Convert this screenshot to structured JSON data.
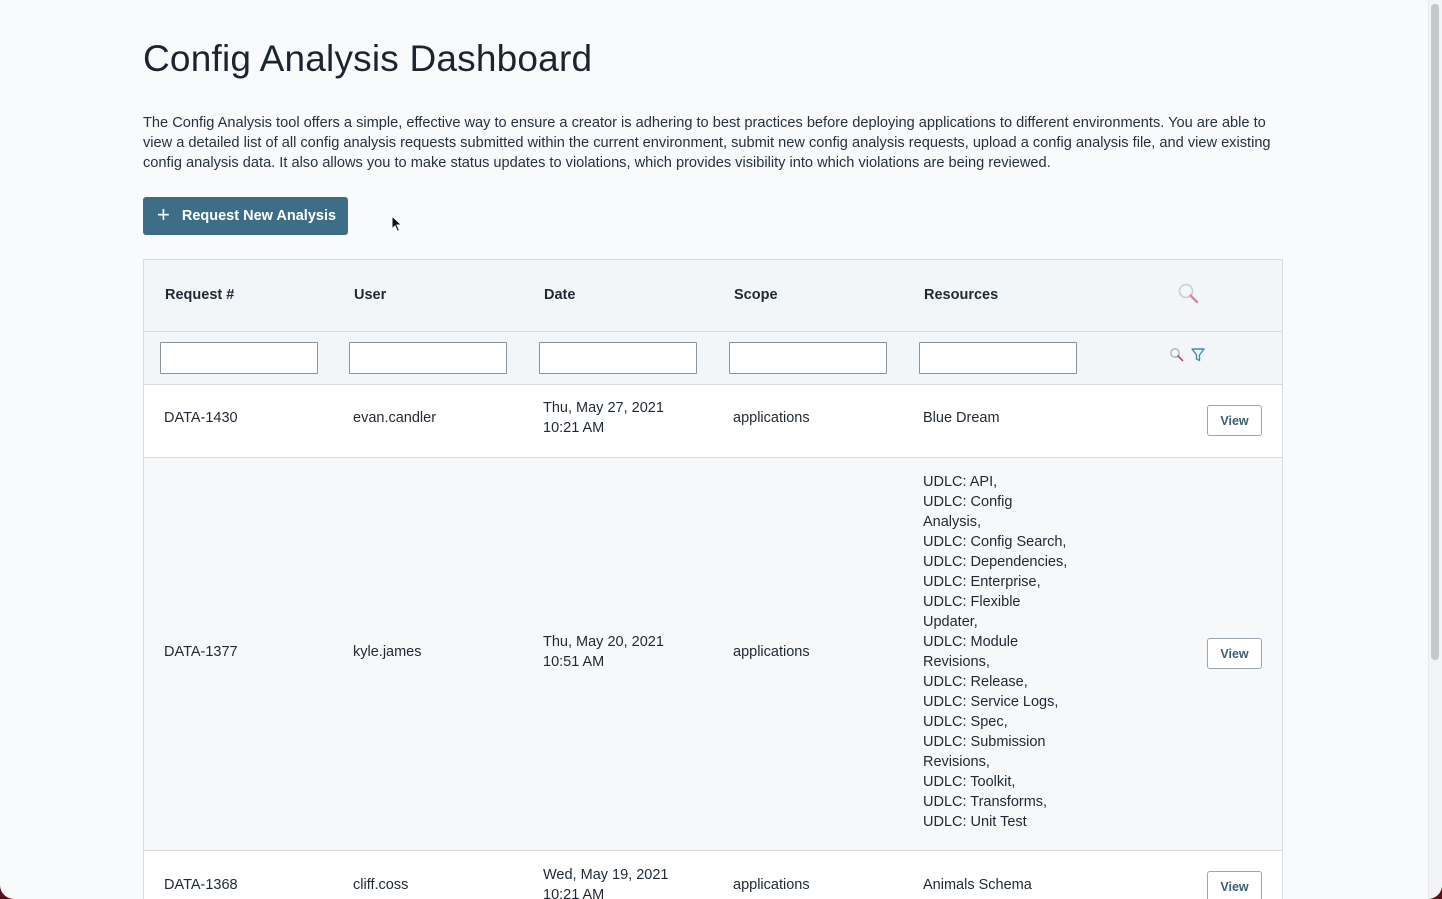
{
  "page": {
    "title": "Config Analysis Dashboard",
    "description": "The Config Analysis tool offers a simple, effective way to ensure a creator is adhering to best practices before deploying applications to different environments. You are able to view a detailed list of all config analysis requests submitted within the current environment, submit new config analysis requests, upload a config analysis file, and view existing config analysis data. It also allows you to make status updates to violations, which provides visibility into which violations are being reviewed."
  },
  "actions": {
    "request_label": "Request New Analysis"
  },
  "table": {
    "columns": [
      "Request #",
      "User",
      "Date",
      "Scope",
      "Resources"
    ],
    "view_label": "View",
    "rows": [
      {
        "request": "DATA-1430",
        "user": "evan.candler",
        "date_line1": "Thu, May 27, 2021",
        "date_line2": "10:21 AM",
        "scope": "applications",
        "resources": [
          "Blue Dream"
        ]
      },
      {
        "request": "DATA-1377",
        "user": "kyle.james",
        "date_line1": "Thu, May 20, 2021",
        "date_line2": "10:51 AM",
        "scope": "applications",
        "resources": [
          "UDLC: API,",
          "UDLC: Config",
          "Analysis,",
          "UDLC: Config Search,",
          "UDLC: Dependencies,",
          "UDLC: Enterprise,",
          "UDLC: Flexible",
          "Updater,",
          "UDLC: Module",
          "Revisions,",
          "UDLC: Release,",
          "UDLC: Service Logs,",
          "UDLC: Spec,",
          "UDLC: Submission",
          "Revisions,",
          "UDLC: Toolkit,",
          "UDLC: Transforms,",
          "UDLC: Unit Test"
        ]
      },
      {
        "request": "DATA-1368",
        "user": "cliff.coss",
        "date_line1": "Wed, May 19, 2021",
        "date_line2": "10:21 AM",
        "scope": "applications",
        "resources": [
          "Animals Schema"
        ]
      }
    ]
  },
  "colors": {
    "primary": "#3e6e87",
    "filter_icon": "#3d8fb0",
    "search_icon": "#c0506a"
  }
}
